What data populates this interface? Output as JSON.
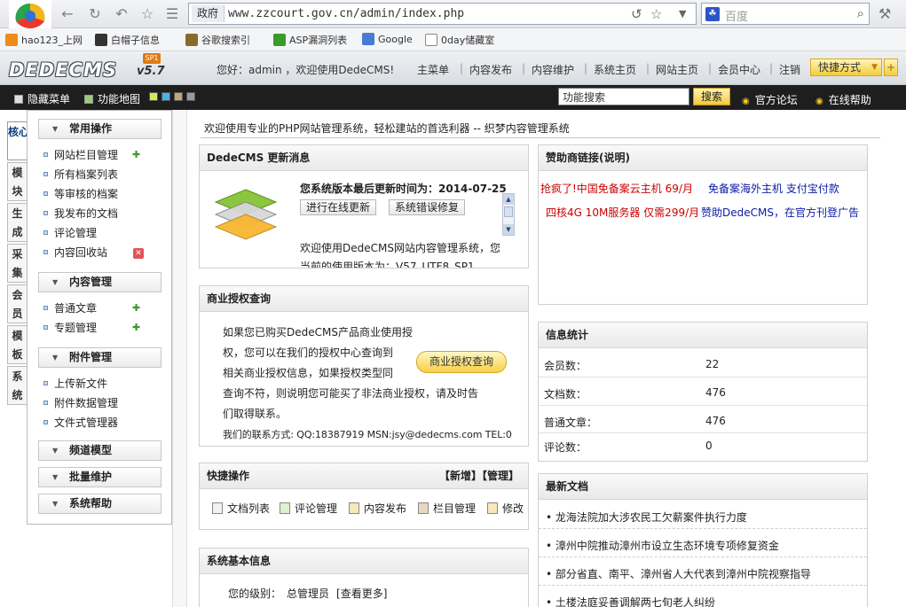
{
  "browser": {
    "url_tag": "政府",
    "url": "www.zzcourt.gov.cn/admin/index.php",
    "search_placeholder": "百度",
    "bookmarks": [
      "hao123_上网",
      "白帽子信息",
      "谷歌搜索引",
      "ASP漏洞列表",
      "Google",
      "0day储藏室"
    ]
  },
  "header": {
    "logo": "DEDECMS",
    "version": "v5.7",
    "sp": "SP1",
    "greeting": "您好：admin ，欢迎使用DedeCMS!",
    "nav": [
      "主菜单",
      "内容发布",
      "内容维护",
      "系统主页",
      "网站主页",
      "会员中心",
      "注销"
    ],
    "quick_label": "快捷方式"
  },
  "toolbar": {
    "hide_menu": "隐藏菜单",
    "site_map": "功能地图",
    "search_value": "功能搜索",
    "search_btn": "搜索",
    "forum": "官方论坛",
    "help": "在线帮助"
  },
  "vtabs": [
    "核心",
    "模块",
    "生成",
    "采集",
    "会员",
    "模板",
    "系统"
  ],
  "leftmenu": {
    "groups": [
      {
        "title": "常用操作",
        "items": [
          "网站栏目管理",
          "所有档案列表",
          "等审核的档案",
          "我发布的文档",
          "评论管理",
          "内容回收站"
        ]
      },
      {
        "title": "内容管理",
        "items": [
          "普通文章",
          "专题管理"
        ]
      },
      {
        "title": "附件管理",
        "items": [
          "上传新文件",
          "附件数据管理",
          "文件式管理器"
        ]
      },
      {
        "title": "频道模型",
        "items": []
      },
      {
        "title": "批量维护",
        "items": []
      },
      {
        "title": "系统帮助",
        "items": []
      }
    ]
  },
  "main": {
    "welcome": "欢迎使用专业的PHP网站管理系统，轻松建站的首选利器 -- 织梦内容管理系统",
    "update": {
      "title": "DedeCMS 更新消息",
      "version_time": "您系统版本最后更新时间为：2014-07-25",
      "btn_update": "进行在线更新",
      "btn_fix": "系统错误修复",
      "text1": "欢迎使用DedeCMS网站内容管理系统，您",
      "text2": "当前的使用版本为：V57_UTF8_SP1"
    },
    "license": {
      "title": "商业授权查询",
      "lines": [
        "如果您已购买DedeCMS产品商业使用授",
        "权，您可以在我们的授权中心查询到",
        "相关商业授权信息，如果授权类型同",
        "查询不符，则说明您可能买了非法商业授权，请及时告",
        "们取得联系。"
      ],
      "contact": "我们的联系方式: QQ:18387919 MSN:jsy@dedecms.com TEL:0",
      "btn": "商业授权查询"
    },
    "quick": {
      "title": "快捷操作",
      "actions": "【新增】【管理】",
      "items": [
        "文档列表",
        "评论管理",
        "内容发布",
        "栏目管理",
        "修改"
      ]
    },
    "sysinfo": {
      "title": "系统基本信息",
      "level_label": "您的级别：",
      "level_value": "总管理员",
      "more": "[查看更多]"
    },
    "sponsor": {
      "title": "赞助商链接(说明)",
      "links": [
        {
          "text": "抢疯了!中国免备案云主机 69/月",
          "color": "#cc0000"
        },
        {
          "text": "免备案海外主机 支付宝付款",
          "color": "#0a1aa8"
        },
        {
          "text": "四核4G 10M服务器 仅需299/月",
          "color": "#cc0000"
        },
        {
          "text": "赞助DedeCMS，在官方刊登广告",
          "color": "#0a1aa8"
        }
      ]
    },
    "stats": {
      "title": "信息统计",
      "rows": [
        {
          "label": "会员数：",
          "value": "22"
        },
        {
          "label": "文档数：",
          "value": "476"
        },
        {
          "label": "普通文章：",
          "value": "476"
        },
        {
          "label": "评论数：",
          "value": "0"
        }
      ]
    },
    "latest": {
      "title": "最新文档",
      "items": [
        "• 龙海法院加大涉农民工欠薪案件执行力度",
        "• 漳州中院推动漳州市设立生态环境专项修复资金",
        "• 部分省直、南平、漳州省人大代表到漳州中院视察指导",
        "• 土楼法庭妥善调解两七旬老人纠纷"
      ]
    }
  }
}
